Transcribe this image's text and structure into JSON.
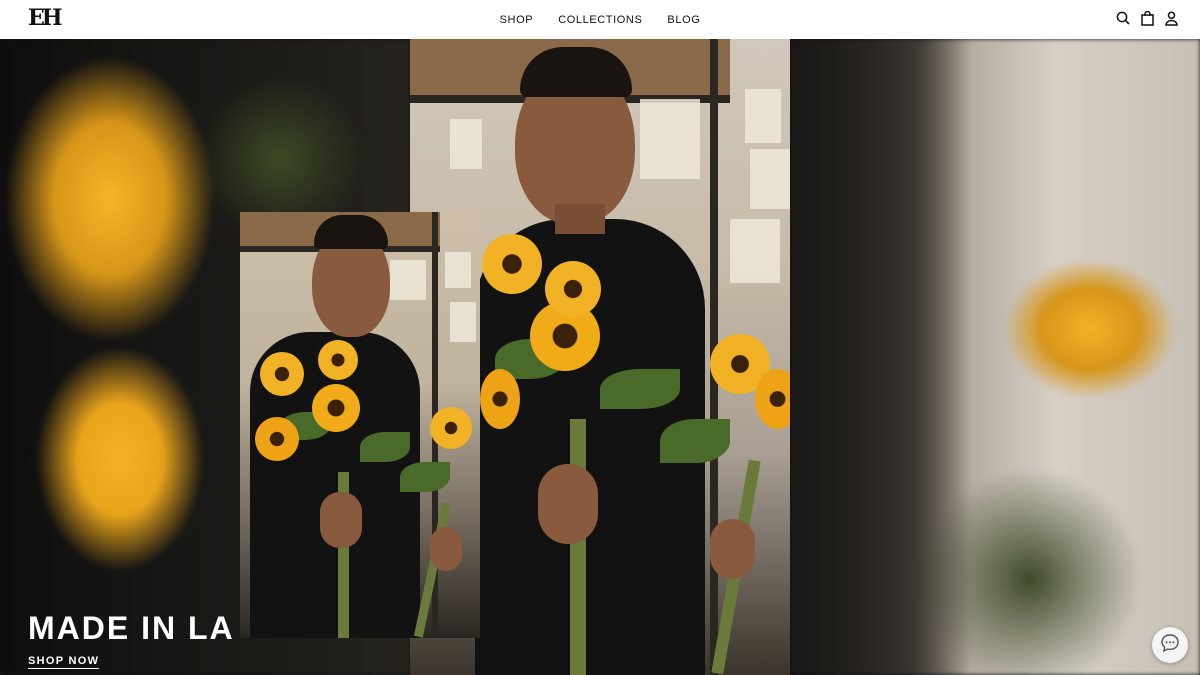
{
  "header": {
    "logo_text": "EH",
    "nav": [
      {
        "label": "SHOP"
      },
      {
        "label": "COLLECTIONS"
      },
      {
        "label": "BLOG"
      }
    ],
    "icons": [
      "search-icon",
      "bag-icon",
      "account-icon"
    ]
  },
  "hero": {
    "headline": "MADE IN LA",
    "cta_label": "SHOP NOW"
  },
  "chat": {
    "icon": "chat-bubble-icon"
  },
  "colors": {
    "header_bg": "#ffffff",
    "text_dark": "#111111",
    "text_light": "#ffffff",
    "sunflower": "#f2b226"
  }
}
